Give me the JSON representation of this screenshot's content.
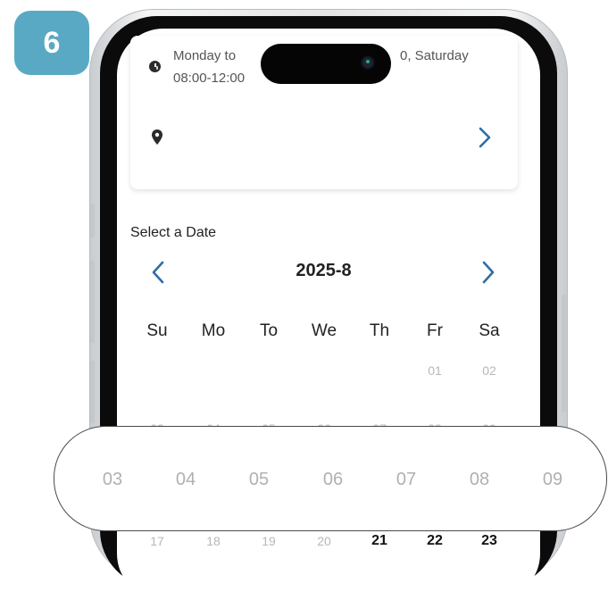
{
  "step": {
    "number": "6",
    "color": "#5aa9c4"
  },
  "store": {
    "hours_line1": "Monday to ",
    "hours_line1_end": "0, Saturday",
    "hours_line2": "08:00-12:00",
    "icons": {
      "hours": "clock-icon",
      "location": "map-pin-icon",
      "open": "chevron-right-icon"
    }
  },
  "calendar": {
    "section_label": "Select a Date",
    "month": "2025-8",
    "accent": "#2e6da4",
    "prev_icon": "chevron-left-icon",
    "next_icon": "chevron-right-icon",
    "weekdays": [
      "Su",
      "Mo",
      "To",
      "We",
      "Th",
      "Fr",
      "Sa"
    ],
    "week1": [
      "01",
      "02"
    ],
    "week2_partial": [
      "03",
      "04",
      "05",
      "06",
      "07",
      "08",
      "09"
    ],
    "last_week_disabled": [
      "17",
      "18",
      "19",
      "20"
    ],
    "last_week_available": [
      "21",
      "22",
      "23"
    ]
  },
  "zoom": {
    "days": [
      "03",
      "04",
      "05",
      "06",
      "07",
      "08",
      "09"
    ]
  }
}
